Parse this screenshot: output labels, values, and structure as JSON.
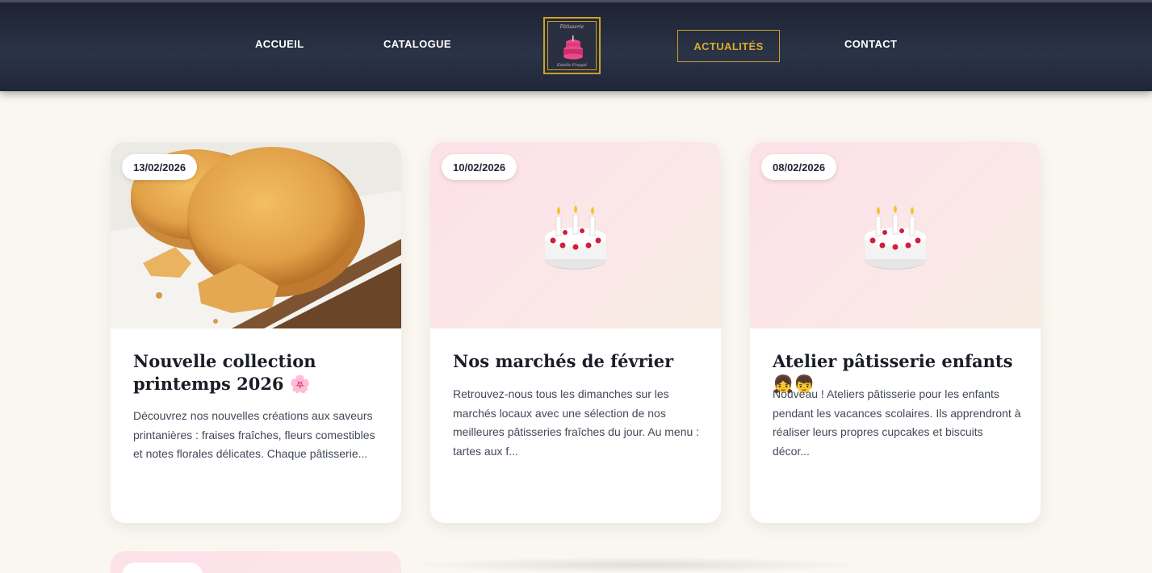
{
  "nav": {
    "accueil": "ACCUEIL",
    "catalogue": "CATALOGUE",
    "actualites": "ACTUALITÉS",
    "contact": "CONTACT",
    "logo_top": "Pâtisserie",
    "logo_bottom": "Estelle Frappé"
  },
  "colors": {
    "header": "#1d2233",
    "accent_gold": "#c9a227",
    "background": "#faf7f1",
    "card_pink": "#fde1e8"
  },
  "news": [
    {
      "date": "13/02/2026",
      "title": "Nouvelle collection printemps 2026 🌸",
      "excerpt": "Découvrez nos nouvelles créations aux saveurs printanières : fraises fraîches, fleurs comestibles et notes florales délicates. Chaque pâtisserie...",
      "media": "cookie-photo"
    },
    {
      "date": "10/02/2026",
      "title": "Nos marchés de février",
      "excerpt": "Retrouvez-nous tous les dimanches sur les marchés locaux avec une sélection de nos meilleures pâtisseries fraîches du jour. Au menu : tartes aux f...",
      "media": "cake-icon"
    },
    {
      "date": "08/02/2026",
      "title": "Atelier pâtisserie enfants 👧👦",
      "excerpt": "Nouveau ! Ateliers pâtisserie pour les enfants pendant les vacances scolaires. Ils apprendront à réaliser leurs propres cupcakes et biscuits décor...",
      "media": "cake-icon"
    }
  ]
}
